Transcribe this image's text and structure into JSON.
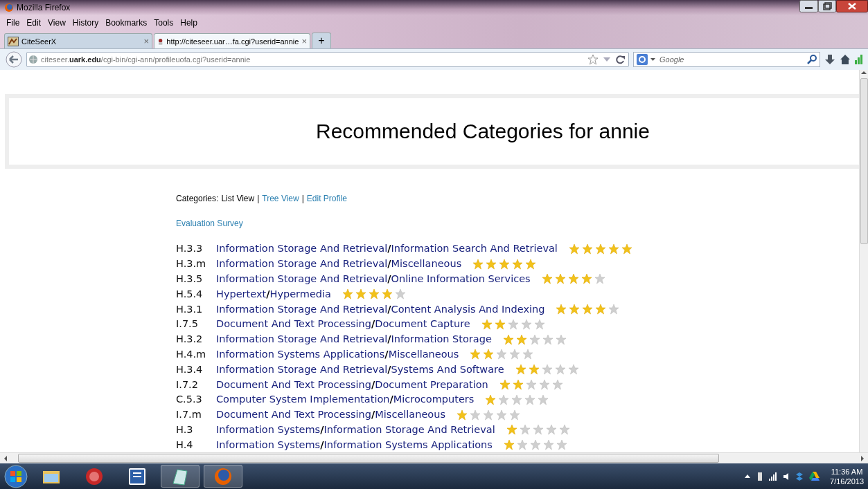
{
  "window": {
    "title": "Mozilla Firefox"
  },
  "menu": [
    "File",
    "Edit",
    "View",
    "History",
    "Bookmarks",
    "Tools",
    "Help"
  ],
  "tabs": [
    {
      "label": "CiteSeerX",
      "selected": false,
      "close": "×"
    },
    {
      "label": "http://citeseer.uar…fa.cgi?userid=annie",
      "selected": true,
      "close": "×"
    }
  ],
  "new_tab": "+",
  "address": {
    "url": "citeseer.**uark.edu**/cgi-bin/cgi-ann/profileuofa.cgi?userid=annie"
  },
  "search": {
    "placeholder": "Google"
  },
  "page": {
    "title": "Recommended Categories for annie",
    "nav_label": "Categories:",
    "nav": [
      {
        "label": "List View",
        "kind": "current"
      },
      {
        "label": "Tree View",
        "kind": "link"
      },
      {
        "label": "Edit Profile",
        "kind": "link"
      }
    ],
    "separator": "|",
    "survey_link": "Evaluation Survey",
    "categories": [
      {
        "code": "H.3.3",
        "path": "Information Storage And Retrieval**/**Information Search And Retrieval",
        "stars": 5
      },
      {
        "code": "H.3.m",
        "path": "Information Storage And Retrieval**/**Miscellaneous",
        "stars": 5
      },
      {
        "code": "H.3.5",
        "path": "Information Storage And Retrieval**/**Online Information Services",
        "stars": 4
      },
      {
        "code": "H.5.4",
        "path": "Hypertext**/**Hypermedia",
        "stars": 4
      },
      {
        "code": "H.3.1",
        "path": "Information Storage And Retrieval**/**Content Analysis And Indexing",
        "stars": 4
      },
      {
        "code": "I.7.5",
        "path": "Document And Text Processing**/**Document Capture",
        "stars": 2
      },
      {
        "code": "H.3.2",
        "path": "Information Storage And Retrieval**/**Information Storage",
        "stars": 2
      },
      {
        "code": "H.4.m",
        "path": "Information Systems Applications**/**Miscellaneous",
        "stars": 2
      },
      {
        "code": "H.3.4",
        "path": "Information Storage And Retrieval**/**Systems And Software",
        "stars": 2
      },
      {
        "code": "I.7.2",
        "path": "Document And Text Processing**/**Document Preparation",
        "stars": 2
      },
      {
        "code": "C.5.3",
        "path": "Computer System Implementation**/**Microcomputers",
        "stars": 1
      },
      {
        "code": "I.7.m",
        "path": "Document And Text Processing**/**Miscellaneous",
        "stars": 1
      },
      {
        "code": "H.3",
        "path": "Information Systems**/**Information Storage And Retrieval",
        "stars": 1
      },
      {
        "code": "H.4",
        "path": "Information Systems**/**Information Systems Applications",
        "stars": 1
      }
    ]
  },
  "taskbar": {
    "time": "11:36 AM",
    "date": "7/16/2013"
  }
}
